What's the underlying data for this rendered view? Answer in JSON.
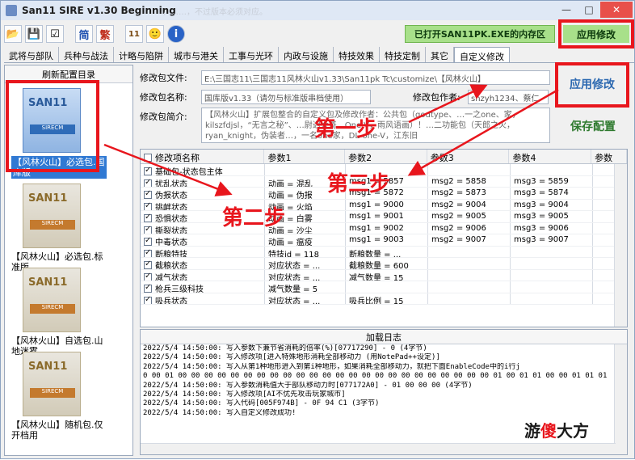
{
  "window": {
    "title": "San11 SIRE v1.30 Beginning",
    "faded_banner": "，……，不过版本必须对应。",
    "controls": [
      "—",
      "□",
      "✕"
    ]
  },
  "toolbar": {
    "buttons": [
      "📂",
      "💾",
      "☑",
      "简",
      "繁",
      "11",
      "🙂",
      "i"
    ],
    "status_text": "已打开SAN11PK.EXE的内存区",
    "apply_label": "应用修改"
  },
  "tabs": [
    "武将与部队",
    "兵种与战法",
    "计略与陷阱",
    "城市与港关",
    "工事与光环",
    "内政与设施",
    "特技效果",
    "特技定制",
    "其它",
    "自定义修改"
  ],
  "sidebar": {
    "refresh_label": "刷新配置目录",
    "items": [
      {
        "logo": "SAN11",
        "band": "SIRECM",
        "label": "【风林火山】必选包.国库版"
      },
      {
        "logo": "SAN11",
        "band": "SIRECM",
        "label": "【风林火山】必选包.标准版"
      },
      {
        "logo": "SAN11",
        "band": "SIRECM",
        "label": "【风林火山】自选包.山地迷雾"
      },
      {
        "logo": "SAN11",
        "band": "SIRECM",
        "label": "【风林火山】随机包.仅开档用"
      }
    ]
  },
  "form": {
    "file_label": "修改包文件:",
    "file_value": "E:\\三国志11\\三国志11风林火山v1.33\\San11pk Tc\\customize\\【风林火山】",
    "name_label": "修改包名称:",
    "name_value": "国库版v1.33（请勿与标准版串档使用）",
    "author_label": "修改包作者:",
    "author_value": "shzyh1234、蔡仁",
    "desc_label": "修改包简介:",
    "desc_value": "【风林火山】扩展包整合的自定义包及修改作者：公共包（godtype、…一之one、家，kilszfdjsl，“无言之秘”、…尉迟大哥、One-V，雨风语画）！…二功能包（天郎之火，ryan_knight，伪装者…，一名one家，DL-one-V，江东旧"
  },
  "side_buttons": {
    "apply_label": "应用修改",
    "save_label": "保存配置"
  },
  "grid": {
    "headers": [
      "修改项名称",
      "参数1",
      "参数2",
      "参数3",
      "参数4",
      "参数"
    ],
    "rows": [
      {
        "name": "基础包-状态包主体",
        "p1": "",
        "p2": "",
        "p3": "",
        "p4": ""
      },
      {
        "name": "扰乱状态",
        "p1": "动画 = 混乱",
        "p2": "msg1 = 5857",
        "p3": "msg2 = 5858",
        "p4": "msg3 = 5859"
      },
      {
        "name": "伪报状态",
        "p1": "动画 = 伪报",
        "p2": "msg1 = 5872",
        "p3": "msg2 = 5873",
        "p4": "msg3 = 5874"
      },
      {
        "name": "挑衅状态",
        "p1": "动画 = 火焰",
        "p2": "msg1 = 9000",
        "p3": "msg2 = 9004",
        "p4": "msg3 = 9004"
      },
      {
        "name": "恐惧状态",
        "p1": "动画 = 白雾",
        "p2": "msg1 = 9001",
        "p3": "msg2 = 9005",
        "p4": "msg3 = 9005"
      },
      {
        "name": "撕裂状态",
        "p1": "动画 = 沙尘",
        "p2": "msg1 = 9002",
        "p3": "msg2 = 9006",
        "p4": "msg3 = 9006"
      },
      {
        "name": "中毒状态",
        "p1": "动画 = 瘟疫",
        "p2": "msg1 = 9003",
        "p3": "msg2 = 9007",
        "p4": "msg3 = 9007"
      },
      {
        "name": "断粮特技",
        "p1": "特技id = 118",
        "p2": "断粮数量 = ...",
        "p3": "",
        "p4": ""
      },
      {
        "name": "截粮状态",
        "p1": "对应状态 = ...",
        "p2": "截粮数量 = 600",
        "p3": "",
        "p4": ""
      },
      {
        "name": "减气状态",
        "p1": "对应状态 = ...",
        "p2": "减气数量 = 15",
        "p3": "",
        "p4": ""
      },
      {
        "name": "枪兵三级科技",
        "p1": "减气数量 = 5",
        "p2": "",
        "p3": "",
        "p4": ""
      },
      {
        "name": "吸兵状态",
        "p1": "对应状态 = ...",
        "p2": "吸兵比例 = 15",
        "p3": "",
        "p4": ""
      }
    ]
  },
  "log": {
    "title": "加载日志",
    "lines": [
      "2022/5/4 14:50:00: 写入参数下兼节省消耗的倍率(%)[07717290] - 0 (4字节)",
      "2022/5/4 14:50:00: 写入修改项[进入特殊地形消耗全部移动力 (用NotePad++设定)]",
      "2022/5/4 14:50:00: 写入从第1种地形进入到第i种地形，如果消耗全部移动力，就把下面EnableCode中的i行j",
      "0 00 01 00 00 00 00 00 00 00 00 00 00 00 00 00 00 00 00 00 00 00 00 00 00 00 00 01 00 01 01 00 00 01 01 01",
      "2022/5/4 14:50:00: 写入参数消耗值大于部队移动力时[077172A0] - 01 00 00 00 (4字节)",
      "2022/5/4 14:50:00: 写入修改项[AI不优先攻击玩家城市]",
      "2022/5/4 14:50:00: 写入代码[005F974B] - 0F 94 C1 (3字节)",
      "2022/5/4 14:50:00: 写入自定义修改成功!"
    ]
  },
  "annotations": {
    "step1": "第一步",
    "step2": "第二步",
    "step3": "第三步",
    "arrow_color": "#e8161d"
  },
  "watermark": {
    "prefix": "游",
    "highlight": "傻",
    "suffix": "大方"
  }
}
